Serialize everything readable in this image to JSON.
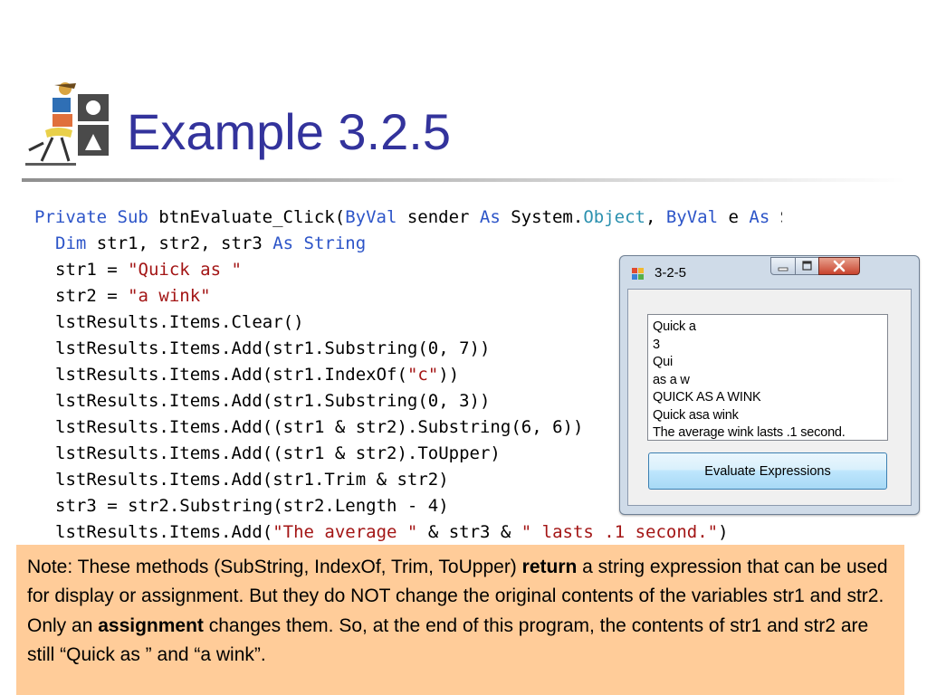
{
  "slide": {
    "title": "Example 3.2.5"
  },
  "code": {
    "l1": {
      "a": "Private Sub",
      "b": " btnEvaluate_Click(",
      "c": "ByVal",
      "d": " sender ",
      "e": "As",
      "f": " System.",
      "g": "Object",
      "h": ", ",
      "i": "ByVal",
      "j": " e ",
      "k": "As",
      "l": " Sy"
    },
    "l2": {
      "a": "Dim",
      "b": " str1, str2, str3 ",
      "c": "As String"
    },
    "l3": {
      "a": "str1 = ",
      "b": "\"Quick as \""
    },
    "l4": {
      "a": "str2 = ",
      "b": "\"a wink\""
    },
    "l5": "lstResults.Items.Clear()",
    "l6": "lstResults.Items.Add(str1.Substring(0, 7))",
    "l7": {
      "a": "lstResults.Items.Add(str1.IndexOf(",
      "b": "\"c\"",
      "c": "))"
    },
    "l8": "lstResults.Items.Add(str1.Substring(0, 3))",
    "l9": "lstResults.Items.Add((str1 & str2).Substring(6, 6))",
    "l10": "lstResults.Items.Add((str1 & str2).ToUpper)",
    "l11": "lstResults.Items.Add(str1.Trim & str2)",
    "l12": "str3 = str2.Substring(str2.Length - 4)",
    "l13": {
      "a": "lstResults.Items.Add(",
      "b": "\"The average \"",
      "c": " & str3 & ",
      "d": "\" lasts .1 second.\"",
      "e": ")"
    }
  },
  "window": {
    "title": "3-2-5",
    "list_items": [
      "Quick a",
      "3",
      "Qui",
      "as a w",
      "QUICK AS A WINK",
      "Quick asa wink",
      "The average wink lasts .1 second."
    ],
    "button_label": "Evaluate Expressions"
  },
  "note": {
    "p1": "Note: These methods (SubString, IndexOf, Trim, ToUpper)  ",
    "b1": "return",
    "p2": " a string expression that can be used for display or assignment. But they do NOT change the original contents of the variables str1 and str2. Only an ",
    "b2": "assignment",
    "p3": " changes them. So, at the end of this program, the contents of str1 and str2 are still “Quick as ” and “a wink”."
  },
  "colors": {
    "title": "#33339c",
    "keyword": "#2c54c8",
    "type": "#2b91af",
    "string": "#a31515",
    "note_bg": "#ffcc99"
  }
}
